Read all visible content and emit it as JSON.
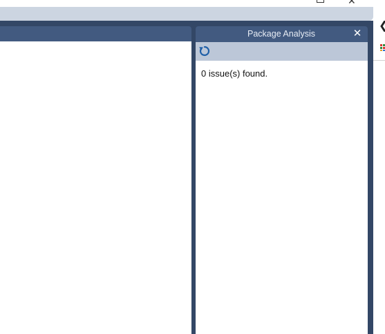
{
  "tool_window": {
    "title": "Package Analysis",
    "close_glyph": "✕",
    "toolbar": {
      "refresh_icon": "refresh-icon"
    },
    "result_text": "0 issue(s) found."
  },
  "window_controls": {
    "restore_icon": "restore-icon",
    "close_glyph": "✕"
  },
  "right_edge": {
    "back_glyph": "❮",
    "apps_icon": "apps-grid-icon"
  },
  "colors": {
    "frame": "#334766",
    "pane_header": "#425a80",
    "toolbar": "#bcc7d8",
    "top_strip": "#ccd5e1",
    "refresh_icon": "#1f5fa8"
  }
}
